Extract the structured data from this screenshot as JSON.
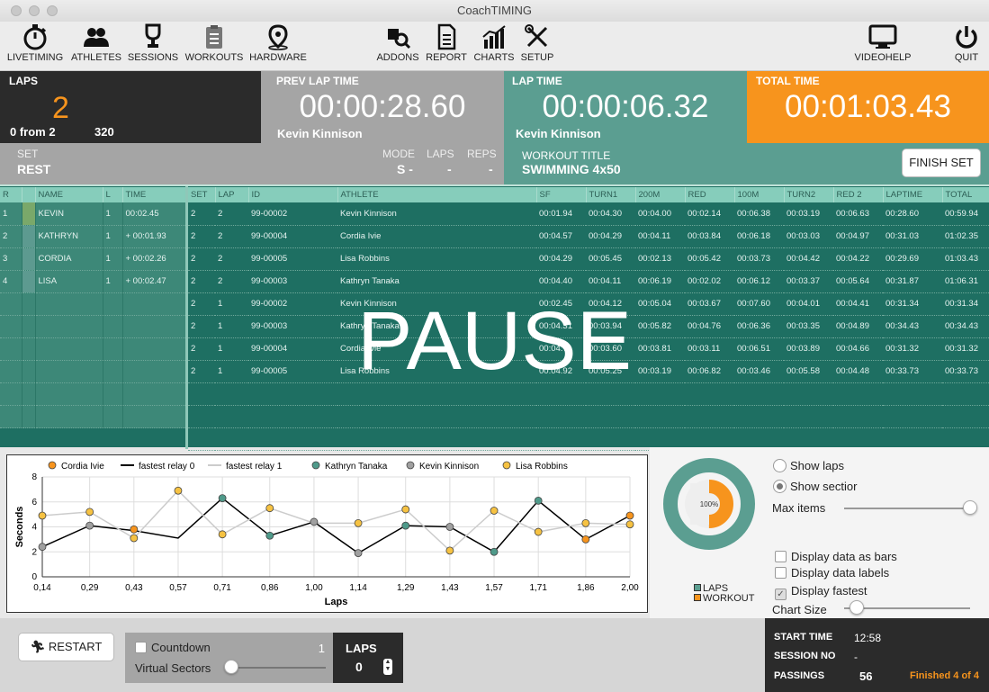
{
  "window": {
    "title": "CoachTIMING"
  },
  "toolbar": {
    "livetiming": "LIVETIMING",
    "athletes": "ATHLETES",
    "sessions": "SESSIONS",
    "workouts": "WORKOUTS",
    "hardware": "HARDWARE",
    "addons": "ADDONS",
    "report": "REPORT",
    "charts": "CHARTS",
    "setup": "SETUP",
    "videohelp": "VIDEOHELP",
    "quit": "QUIT"
  },
  "laps_panel": {
    "title": "LAPS",
    "value": "2",
    "from": "0 from 2",
    "count": "320"
  },
  "prev_lap": {
    "title": "PREV LAP TIME",
    "time": "00:00:28.60",
    "athlete": "Kevin  Kinnison"
  },
  "lap_time": {
    "title": "LAP TIME",
    "time": "00:00:06.32",
    "athlete": "Kevin  Kinnison"
  },
  "total_time": {
    "title": "TOTAL TIME",
    "time": "00:01:03.43"
  },
  "set_row": {
    "set_label": "SET",
    "set_value": "REST",
    "mode_label": "MODE",
    "mode_value": "S -",
    "laps_label": "LAPS",
    "laps_value": "-",
    "reps_label": "REPS",
    "reps_value": "-"
  },
  "workout": {
    "title_label": "WORKOUT TITLE",
    "title_value": "SWIMMING 4x50",
    "finish_button": "FINISH SET"
  },
  "colors": {
    "dark": "#2b2b2b",
    "gray": "#a5a5a5",
    "teal": "#5b9e91",
    "orange": "#f7941d",
    "table": "#1e6f62"
  },
  "left_table": {
    "headers": [
      "R",
      "",
      "NAME",
      "L",
      "TIME"
    ],
    "rows": [
      [
        "1",
        "",
        "KEVIN",
        "1",
        "00:02.45"
      ],
      [
        "2",
        "",
        "KATHRYN",
        "1",
        "+ 00:01.93"
      ],
      [
        "3",
        "",
        "CORDIA",
        "1",
        "+ 00:02.26"
      ],
      [
        "4",
        "",
        "LISA",
        "1",
        "+ 00:02.47"
      ]
    ]
  },
  "main_table": {
    "headers": [
      "SET",
      "LAP",
      "ID",
      "ATHLETE",
      "SF",
      "TURN1",
      "200M",
      "RED",
      "100M",
      "TURN2",
      "RED 2",
      "LAPTIME",
      "TOTAL"
    ],
    "rows": [
      [
        "2",
        "2",
        "99-00002",
        "Kevin  Kinnison",
        "00:01.94",
        "00:04.30",
        "00:04.00",
        "00:02.14",
        "00:06.38",
        "00:03.19",
        "00:06.63",
        "00:28.60",
        "00:59.94"
      ],
      [
        "2",
        "2",
        "99-00004",
        "Cordia Ivie",
        "00:04.57",
        "00:04.29",
        "00:04.11",
        "00:03.84",
        "00:06.18",
        "00:03.03",
        "00:04.97",
        "00:31.03",
        "01:02.35"
      ],
      [
        "2",
        "2",
        "99-00005",
        "Lisa Robbins",
        "00:04.29",
        "00:05.45",
        "00:02.13",
        "00:05.42",
        "00:03.73",
        "00:04.42",
        "00:04.22",
        "00:29.69",
        "01:03.43"
      ],
      [
        "2",
        "2",
        "99-00003",
        "Kathryn Tanaka",
        "00:04.40",
        "00:04.11",
        "00:06.19",
        "00:02.02",
        "00:06.12",
        "00:03.37",
        "00:05.64",
        "00:31.87",
        "01:06.31"
      ],
      [
        "2",
        "1",
        "99-00002",
        "Kevin  Kinnison",
        "00:02.45",
        "00:04.12",
        "00:05.04",
        "00:03.67",
        "00:07.60",
        "00:04.01",
        "00:04.41",
        "00:31.34",
        "00:31.34"
      ],
      [
        "2",
        "1",
        "99-00003",
        "Kathryn Tanaka",
        "00:04.31",
        "00:03.94",
        "00:05.82",
        "00:04.76",
        "00:06.36",
        "00:03.35",
        "00:04.89",
        "00:34.43",
        "00:34.43"
      ],
      [
        "2",
        "1",
        "99-00004",
        "Cordia Ivie",
        "00:04.71",
        "00:03.60",
        "00:03.81",
        "00:03.11",
        "00:06.51",
        "00:03.89",
        "00:04.66",
        "00:31.32",
        "00:31.32"
      ],
      [
        "2",
        "1",
        "99-00005",
        "Lisa Robbins",
        "00:04.92",
        "00:05.25",
        "00:03.19",
        "00:06.82",
        "00:03.46",
        "00:05.58",
        "00:04.48",
        "00:33.73",
        "00:33.73"
      ]
    ]
  },
  "overlay": {
    "pause_text": "PAUSE"
  },
  "chart_data": {
    "type": "line",
    "xlabel": "Laps",
    "ylabel": "Seconds",
    "ylim": [
      0,
      8
    ],
    "y_ticks": [
      "0",
      "2",
      "4",
      "6",
      "8"
    ],
    "x_ticks": [
      "0,14",
      "0,29",
      "0,43",
      "0,57",
      "0,71",
      "0,86",
      "1,00",
      "1,14",
      "1,29",
      "1,43",
      "1,57",
      "1,71",
      "1,86",
      "2,00"
    ],
    "x": [
      0.14,
      0.29,
      0.43,
      0.57,
      0.71,
      0.86,
      1.0,
      1.14,
      1.29,
      1.43,
      1.57,
      1.71,
      1.86,
      2.0
    ],
    "legend_position": "top",
    "series": [
      {
        "name": "Cordia Ivie",
        "color": "#f7941d",
        "marker": true,
        "line": false,
        "points": [
          [
            0.43,
            3.8
          ],
          [
            1.86,
            3.0
          ],
          [
            2.0,
            4.9
          ]
        ]
      },
      {
        "name": "fastest relay 0",
        "color": "#000000",
        "marker": false,
        "line": true,
        "values": [
          2.4,
          4.1,
          3.7,
          3.1,
          6.3,
          3.3,
          4.4,
          1.9,
          4.1,
          4.0,
          2.0,
          6.1,
          3.0,
          4.9
        ]
      },
      {
        "name": "fastest relay 1",
        "color": "#cccccc",
        "marker": false,
        "line": true,
        "values": [
          4.9,
          5.2,
          3.1,
          6.9,
          3.4,
          5.5,
          4.3,
          4.3,
          5.4,
          2.1,
          5.3,
          3.6,
          4.3,
          4.2
        ]
      },
      {
        "name": "Kathryn Tanaka",
        "color": "#4f9a8a",
        "marker": true,
        "line": false,
        "points": [
          [
            0.71,
            6.3
          ],
          [
            0.86,
            3.3
          ],
          [
            1.29,
            4.1
          ],
          [
            1.57,
            2.0
          ],
          [
            1.71,
            6.1
          ]
        ]
      },
      {
        "name": "Kevin  Kinnison",
        "color": "#a0a0a0",
        "marker": true,
        "line": false,
        "points": [
          [
            0.14,
            2.4
          ],
          [
            0.29,
            4.1
          ],
          [
            1.0,
            4.4
          ],
          [
            1.14,
            1.9
          ],
          [
            1.43,
            4.0
          ]
        ]
      },
      {
        "name": "Lisa Robbins",
        "color": "#f6c242",
        "marker": true,
        "line": false,
        "points": [
          [
            0.14,
            4.9
          ],
          [
            0.29,
            5.2
          ],
          [
            0.43,
            3.1
          ],
          [
            0.57,
            6.9
          ],
          [
            0.71,
            3.4
          ],
          [
            0.86,
            5.5
          ],
          [
            1.14,
            4.3
          ],
          [
            1.29,
            5.4
          ],
          [
            1.43,
            2.1
          ],
          [
            1.57,
            5.3
          ],
          [
            1.71,
            3.6
          ],
          [
            1.86,
            4.3
          ],
          [
            2.0,
            4.2
          ]
        ]
      }
    ]
  },
  "donut": {
    "label": "100%",
    "legend": [
      "LAPS",
      "WORKOUT"
    ],
    "fraction": 1.0
  },
  "options": {
    "show_laps": "Show laps",
    "show_section": "Show sectior",
    "max_items": "Max items",
    "max_items_level": 1.0,
    "bars": "Display data as bars",
    "labels": "Display data labels",
    "fastest": "Display fastest",
    "chart_size": "Chart Size",
    "chart_size_level": 0.1
  },
  "bottom": {
    "restart": "RESTART",
    "countdown": "Countdown",
    "countdown_value": "1",
    "virtual_sectors": "Virtual Sectors",
    "laps_label": "LAPS",
    "laps_value": "0",
    "start_time_label": "START TIME",
    "start_time": "12:58",
    "session_label": "SESSION NO",
    "session_value": "-",
    "passings_label": "PASSINGS",
    "passings_value": "56",
    "finished": "Finished 4 of 4"
  }
}
